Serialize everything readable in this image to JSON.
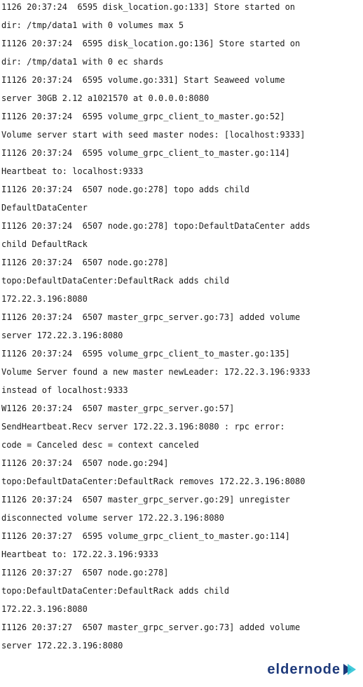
{
  "log_lines": [
    "1126 20:37:24  6595 disk_location.go:133] Store started on",
    "dir: /tmp/data1 with 0 volumes max 5",
    "I1126 20:37:24  6595 disk_location.go:136] Store started on",
    "dir: /tmp/data1 with 0 ec shards",
    "I1126 20:37:24  6595 volume.go:331] Start Seaweed volume",
    "server 30GB 2.12 a1021570 at 0.0.0.0:8080",
    "I1126 20:37:24  6595 volume_grpc_client_to_master.go:52]",
    "Volume server start with seed master nodes: [localhost:9333]",
    "I1126 20:37:24  6595 volume_grpc_client_to_master.go:114]",
    "Heartbeat to: localhost:9333",
    "I1126 20:37:24  6507 node.go:278] topo adds child",
    "DefaultDataCenter",
    "I1126 20:37:24  6507 node.go:278] topo:DefaultDataCenter adds",
    "child DefaultRack",
    "I1126 20:37:24  6507 node.go:278]",
    "topo:DefaultDataCenter:DefaultRack adds child",
    "172.22.3.196:8080",
    "I1126 20:37:24  6507 master_grpc_server.go:73] added volume",
    "server 172.22.3.196:8080",
    "I1126 20:37:24  6595 volume_grpc_client_to_master.go:135]",
    "Volume Server found a new master newLeader: 172.22.3.196:9333",
    "instead of localhost:9333",
    "W1126 20:37:24  6507 master_grpc_server.go:57]",
    "SendHeartbeat.Recv server 172.22.3.196:8080 : rpc error:",
    "code = Canceled desc = context canceled",
    "I1126 20:37:24  6507 node.go:294]",
    "topo:DefaultDataCenter:DefaultRack removes 172.22.3.196:8080",
    "I1126 20:37:24  6507 master_grpc_server.go:29] unregister",
    "disconnected volume server 172.22.3.196:8080",
    "I1126 20:37:27  6595 volume_grpc_client_to_master.go:114]",
    "Heartbeat to: 172.22.3.196:9333",
    "I1126 20:37:27  6507 node.go:278]",
    "topo:DefaultDataCenter:DefaultRack adds child",
    "172.22.3.196:8080",
    "I1126 20:37:27  6507 master_grpc_server.go:73] added volume",
    "server 172.22.3.196:8080"
  ],
  "watermark": {
    "text": "eldernode",
    "icon": "play-arrows-icon",
    "color_text": "#1e3a7b",
    "color_icon_front": "#2ec4d6",
    "color_icon_back": "#1e3a7b"
  }
}
